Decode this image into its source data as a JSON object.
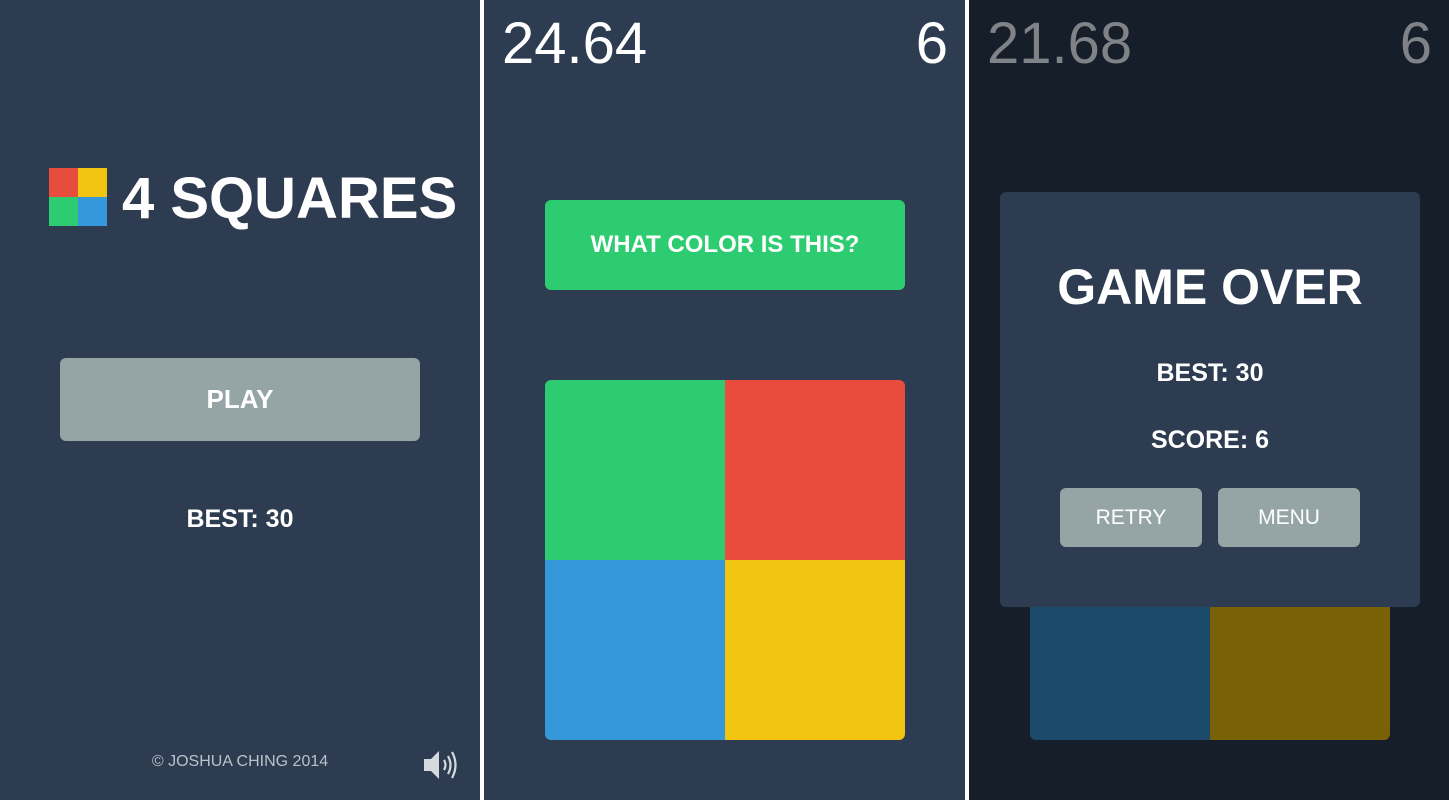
{
  "colors": {
    "background": "#2d3c50",
    "overlay_background": "#161e29",
    "button_gray": "#95a5a6",
    "green": "#2ecc71",
    "red": "#e74c3c",
    "blue": "#3498db",
    "yellow": "#f1c40f",
    "dim_blue": "#1b4a6b",
    "dim_yellow": "#786106",
    "dim_text": "#7f8388"
  },
  "menu": {
    "logo_icon": "four-color-squares-icon",
    "title": "4 SQUARES",
    "play_label": "PLAY",
    "best": "BEST: 30",
    "copyright": "© JOSHUA CHING 2014",
    "sound_icon": "speaker-icon"
  },
  "game": {
    "timer": "24.64",
    "score": "6",
    "prompt": "WHAT COLOR IS THIS?",
    "squares": [
      "green",
      "red",
      "blue",
      "yellow"
    ]
  },
  "game_over": {
    "timer": "21.68",
    "score": "6",
    "title": "GAME OVER",
    "best": "BEST: 30",
    "score_label": "SCORE: 6",
    "retry_label": "RETRY",
    "menu_label": "MENU"
  }
}
